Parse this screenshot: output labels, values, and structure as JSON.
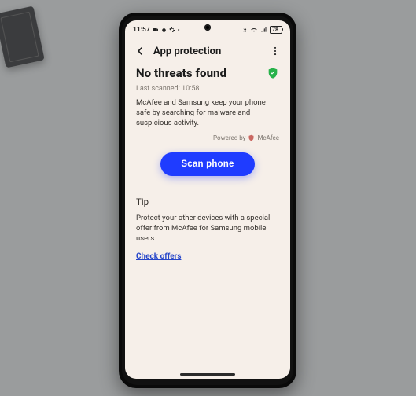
{
  "status_bar": {
    "time": "11:57",
    "battery_text": "78"
  },
  "appbar": {
    "title": "App protection"
  },
  "main": {
    "heading": "No threats found",
    "last_scanned": "Last scanned: 10:58",
    "description": "McAfee and Samsung keep your phone safe by searching for malware and suspicious activity.",
    "powered_by_label": "Powered by",
    "powered_by_brand": "McAfee",
    "scan_button": "Scan phone"
  },
  "tip": {
    "heading": "Tip",
    "body": "Protect your other devices with a special offer from McAfee for Samsung mobile users.",
    "link": "Check offers"
  },
  "colors": {
    "accent": "#1f3cff",
    "shield": "#27b24a",
    "link": "#2545c9"
  }
}
